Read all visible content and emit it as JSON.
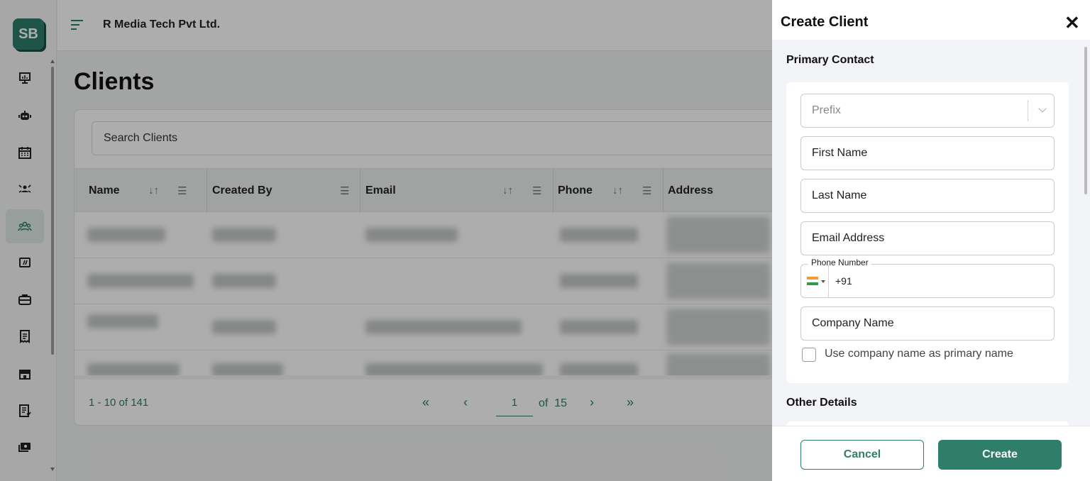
{
  "brand": {
    "logo_text": "SB",
    "accent": "#2f7d6b"
  },
  "header": {
    "org_name": "R Media Tech Pvt Ltd."
  },
  "sidebar": {
    "items": [
      {
        "icon": "presentation-chart-icon"
      },
      {
        "icon": "robot-icon"
      },
      {
        "icon": "calendar-icon"
      },
      {
        "icon": "team-icon"
      },
      {
        "icon": "clients-icon",
        "active": true
      },
      {
        "icon": "ticket-icon"
      },
      {
        "icon": "briefcase-icon"
      },
      {
        "icon": "invoice-icon"
      },
      {
        "icon": "store-icon"
      },
      {
        "icon": "report-icon"
      },
      {
        "icon": "payment-icon"
      }
    ]
  },
  "page": {
    "title": "Clients"
  },
  "table": {
    "search_placeholder": "Search Clients",
    "columns": [
      "Name",
      "Created By",
      "Email",
      "Phone",
      "Address"
    ],
    "rows_count_visible": 4,
    "pagination": {
      "range_text": "1 - 10 of 141",
      "current_page": "1",
      "of_label": "of",
      "total_pages": "15"
    }
  },
  "drawer": {
    "title": "Create Client",
    "primary_section": "Primary Contact",
    "prefix_placeholder": "Prefix",
    "first_name_placeholder": "First Name",
    "last_name_placeholder": "Last Name",
    "email_placeholder": "Email Address",
    "phone_label": "Phone Number",
    "phone_code": "+91",
    "company_placeholder": "Company Name",
    "checkbox_label": "Use company name as primary name",
    "other_section": "Other Details",
    "cancel_label": "Cancel",
    "create_label": "Create"
  }
}
